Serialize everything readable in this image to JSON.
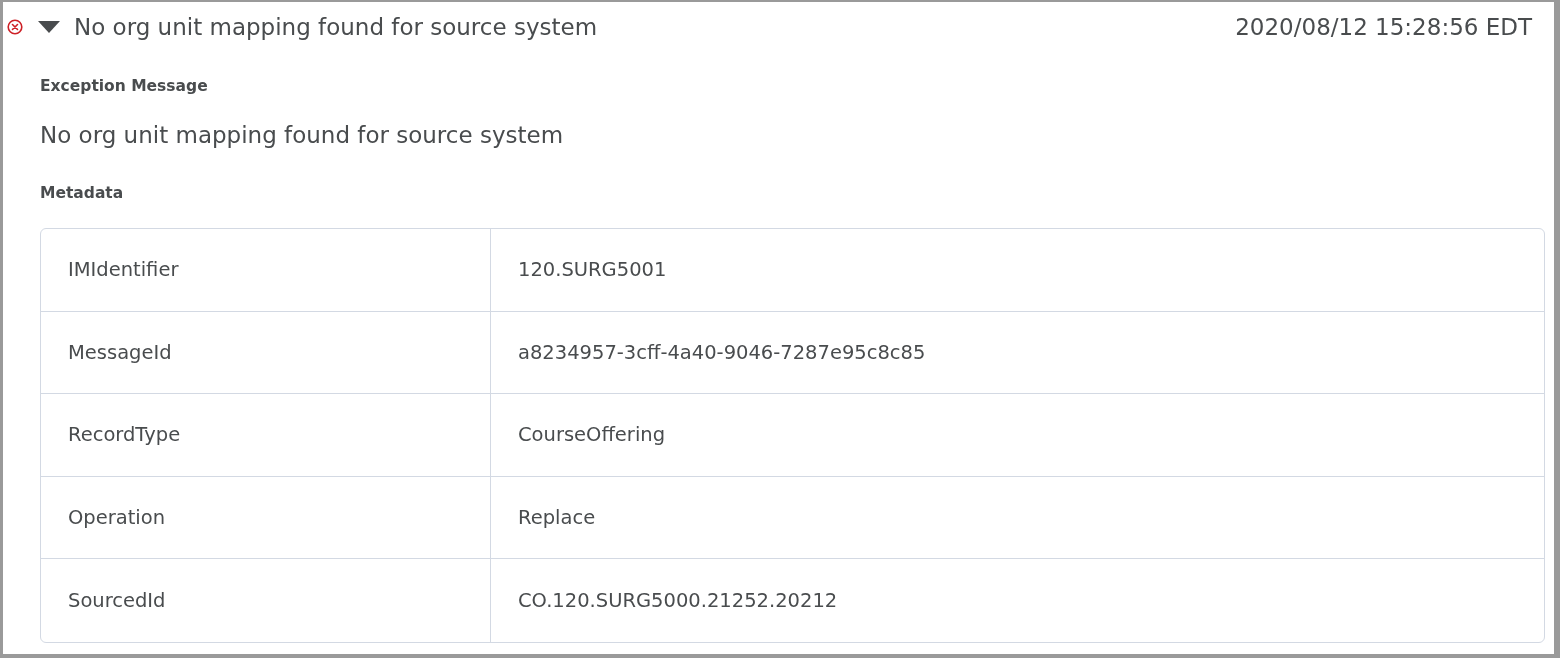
{
  "entry": {
    "error": true,
    "expanded": true,
    "title": "No org unit mapping found for source system",
    "timestamp": "2020/08/12 15:28:56 EDT"
  },
  "exception": {
    "heading": "Exception Message",
    "message": "No org unit mapping found for source system"
  },
  "metadata": {
    "heading": "Metadata",
    "rows": [
      {
        "key": "IMIdentifier",
        "value": "120.SURG5001"
      },
      {
        "key": "MessageId",
        "value": "a8234957-3cff-4a40-9046-7287e95c8c85"
      },
      {
        "key": "RecordType",
        "value": "CourseOffering"
      },
      {
        "key": "Operation",
        "value": "Replace"
      },
      {
        "key": "SourcedId",
        "value": "CO.120.SURG5000.21252.20212"
      }
    ]
  }
}
